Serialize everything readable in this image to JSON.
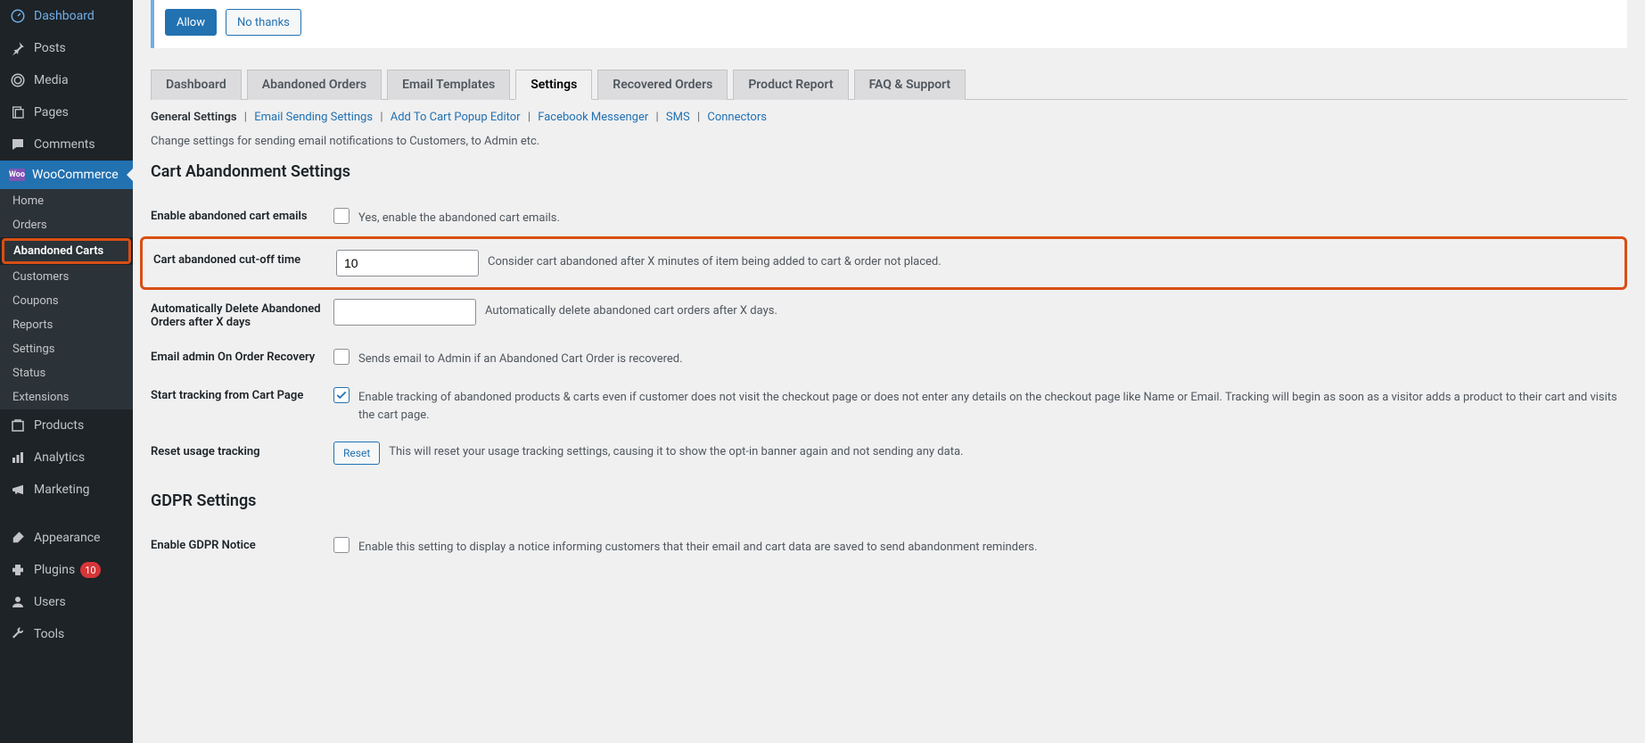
{
  "sidebar": {
    "items": [
      {
        "label": "Dashboard",
        "icon": "gauge"
      },
      {
        "label": "Posts",
        "icon": "pin"
      },
      {
        "label": "Media",
        "icon": "media"
      },
      {
        "label": "Pages",
        "icon": "page"
      },
      {
        "label": "Comments",
        "icon": "comment"
      },
      {
        "label": "WooCommerce",
        "icon": "woo",
        "active": true
      },
      {
        "label": "Products",
        "icon": "products"
      },
      {
        "label": "Analytics",
        "icon": "analytics"
      },
      {
        "label": "Marketing",
        "icon": "marketing"
      },
      {
        "label": "Appearance",
        "icon": "brush"
      },
      {
        "label": "Plugins",
        "icon": "plug",
        "badge": "10"
      },
      {
        "label": "Users",
        "icon": "user"
      },
      {
        "label": "Tools",
        "icon": "wrench"
      }
    ],
    "subitems": [
      {
        "label": "Home"
      },
      {
        "label": "Orders"
      },
      {
        "label": "Abandoned Carts",
        "current": true,
        "highlighted": true
      },
      {
        "label": "Customers"
      },
      {
        "label": "Coupons"
      },
      {
        "label": "Reports"
      },
      {
        "label": "Settings"
      },
      {
        "label": "Status"
      },
      {
        "label": "Extensions"
      }
    ]
  },
  "notice": {
    "allow": "Allow",
    "nothanks": "No thanks"
  },
  "tabs": [
    {
      "label": "Dashboard"
    },
    {
      "label": "Abandoned Orders"
    },
    {
      "label": "Email Templates"
    },
    {
      "label": "Settings",
      "active": true
    },
    {
      "label": "Recovered Orders"
    },
    {
      "label": "Product Report"
    },
    {
      "label": "FAQ & Support"
    }
  ],
  "subnav": [
    {
      "label": "General Settings",
      "current": true
    },
    {
      "label": "Email Sending Settings"
    },
    {
      "label": "Add To Cart Popup Editor"
    },
    {
      "label": "Facebook Messenger"
    },
    {
      "label": "SMS"
    },
    {
      "label": "Connectors"
    }
  ],
  "desc_top": "Change settings for sending email notifications to Customers, to Admin etc.",
  "section_title": "Cart Abandonment Settings",
  "fields": {
    "enable_emails": {
      "label": "Enable abandoned cart emails",
      "desc": "Yes, enable the abandoned cart emails.",
      "checked": false
    },
    "cutoff": {
      "label": "Cart abandoned cut-off time",
      "value": "10",
      "desc": "Consider cart abandoned after X minutes of item being added to cart & order not placed."
    },
    "auto_delete": {
      "label": "Automatically Delete Abandoned Orders after X days",
      "value": "",
      "desc": "Automatically delete abandoned cart orders after X days."
    },
    "email_admin": {
      "label": "Email admin On Order Recovery",
      "desc": "Sends email to Admin if an Abandoned Cart Order is recovered.",
      "checked": false
    },
    "tracking": {
      "label": "Start tracking from Cart Page",
      "desc": "Enable tracking of abandoned products & carts even if customer does not visit the checkout page or does not enter any details on the checkout page like Name or Email. Tracking will begin as soon as a visitor adds a product to their cart and visits the cart page.",
      "checked": true
    },
    "reset": {
      "label": "Reset usage tracking",
      "button": "Reset",
      "desc": "This will reset your usage tracking settings, causing it to show the opt-in banner again and not sending any data."
    }
  },
  "section_title_2": "GDPR Settings",
  "fields2": {
    "gdpr_notice": {
      "label": "Enable GDPR Notice",
      "desc": "Enable this setting to display a notice informing customers that their email and cart data are saved to send abandonment reminders.",
      "checked": false
    }
  }
}
